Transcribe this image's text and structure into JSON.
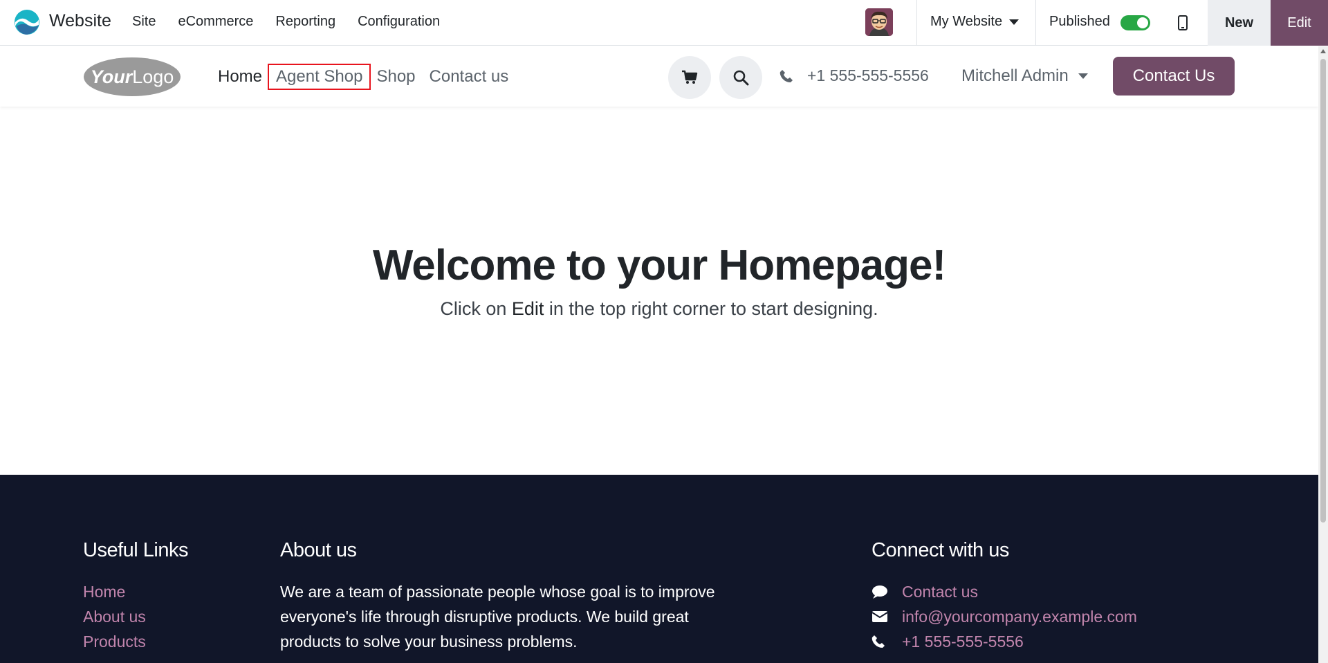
{
  "admin_bar": {
    "app_name": "Website",
    "menu": [
      "Site",
      "eCommerce",
      "Reporting",
      "Configuration"
    ],
    "website_selector": "My Website",
    "published_label": "Published",
    "published": true,
    "new_label": "New",
    "edit_label": "Edit"
  },
  "site_header": {
    "logo_text": "YourLogo",
    "nav": [
      {
        "label": "Home",
        "active": true
      },
      {
        "label": "Agent Shop",
        "highlighted": true
      },
      {
        "label": "Shop"
      },
      {
        "label": "Contact us"
      }
    ],
    "phone": "+1 555-555-5556",
    "user": "Mitchell Admin",
    "cta": "Contact Us"
  },
  "hero": {
    "title_prefix": "Welcome to your ",
    "title_bold": "Homepage",
    "title_suffix": "!",
    "sub_prefix": "Click on ",
    "sub_bold": "Edit",
    "sub_suffix": " in the top right corner to start designing."
  },
  "footer": {
    "useful_links": {
      "title": "Useful Links",
      "links": [
        "Home",
        "About us",
        "Products"
      ]
    },
    "about": {
      "title": "About us",
      "text": "We are a team of passionate people whose goal is to improve everyone's life through disruptive products. We build great products to solve your business problems."
    },
    "connect": {
      "title": "Connect with us",
      "contact": "Contact us",
      "email": "info@yourcompany.example.com",
      "phone": "+1 555-555-5556"
    }
  },
  "colors": {
    "brand": "#714b67",
    "footer_bg": "#111629",
    "footer_link": "#c285ad",
    "highlight": "#e8141d",
    "toggle_on": "#28a745"
  }
}
